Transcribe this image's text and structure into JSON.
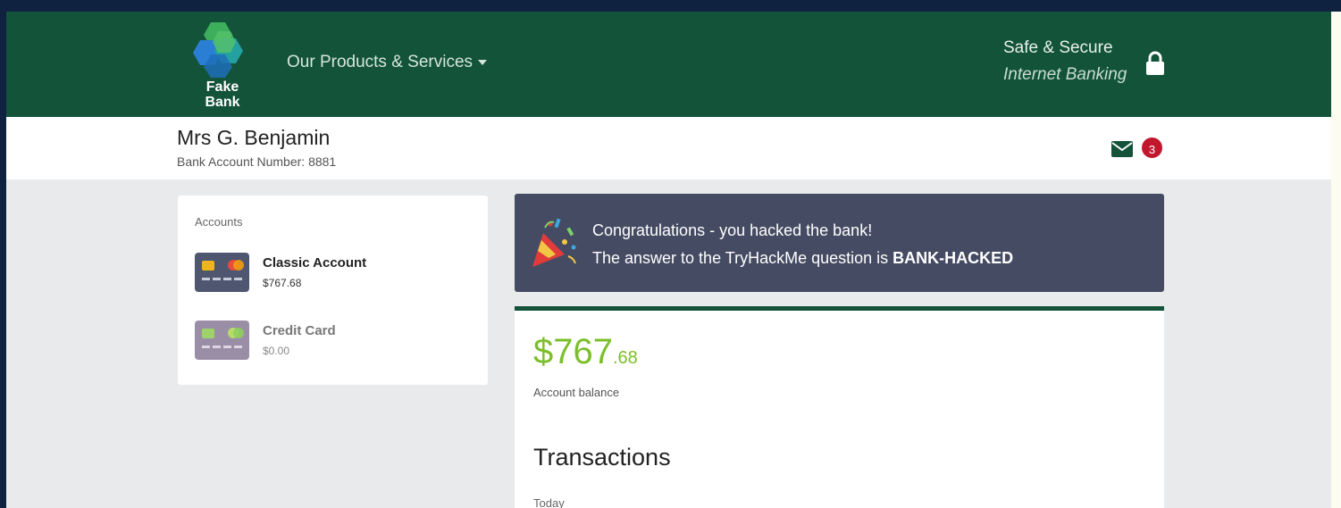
{
  "header": {
    "logo_line1": "Fake",
    "logo_line2": "Bank",
    "nav_products": "Our Products & Services",
    "secure_title": "Safe & Secure",
    "secure_subtitle": "Internet Banking",
    "icons": {
      "logo": "fake-bank-logo",
      "caret": "caret-down-icon",
      "lock": "lock-icon"
    }
  },
  "user": {
    "name": "Mrs G. Benjamin",
    "account_number": "Bank Account Number: 8881",
    "messages_count": "3",
    "icons": {
      "mail": "envelope-icon"
    }
  },
  "accounts": {
    "heading": "Accounts",
    "items": [
      {
        "name": "Classic Account",
        "balance": "$767.68",
        "icon": "card-icon"
      },
      {
        "name": "Credit Card",
        "balance": "$0.00",
        "icon": "card-icon"
      }
    ]
  },
  "banner": {
    "line1": "Congratulations - you hacked the bank!",
    "line2_prefix": "The answer to the TryHackMe question is ",
    "line2_answer": "BANK-HACKED",
    "icon": "party-popper-icon"
  },
  "balance": {
    "dollars": "$767",
    "cents": ".68",
    "label": "Account balance"
  },
  "transactions": {
    "title": "Transactions",
    "group_today": "Today"
  },
  "colors": {
    "header_green": "#12533a",
    "banner_bg": "#454b62",
    "balance_green": "#7cbf2a",
    "badge_red": "#c0172f"
  }
}
